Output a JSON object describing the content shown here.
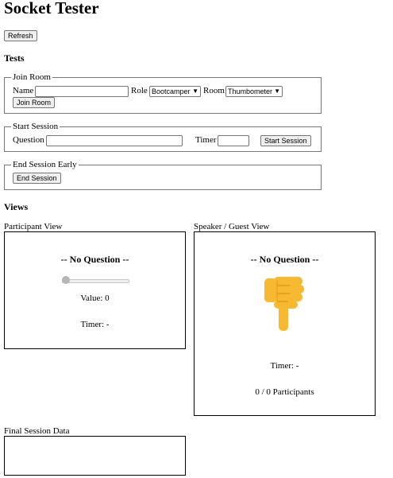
{
  "page_title": "Socket Tester",
  "refresh_label": "Refresh",
  "tests": {
    "heading": "Tests",
    "join_room": {
      "legend": "Join Room",
      "name_label": "Name",
      "name_value": "",
      "role_label": "Role",
      "role_selected": "Bootcamper",
      "room_label": "Room",
      "room_selected": "Thumbometer",
      "button_label": "Join Room"
    },
    "start_session": {
      "legend": "Start Session",
      "question_label": "Question",
      "question_value": "",
      "timer_label": "Timer",
      "timer_value": "",
      "button_label": "Start Session"
    },
    "end_session": {
      "legend": "End Session Early",
      "button_label": "End Session"
    }
  },
  "views": {
    "heading": "Views",
    "participant": {
      "label": "Participant View",
      "question": "-- No Question --",
      "slider_value_fraction": 0,
      "value_text": "Value: 0",
      "timer_text": "Timer: -"
    },
    "speaker": {
      "label": "Speaker / Guest View",
      "question": "-- No Question --",
      "icon": "thumbs-down-icon",
      "icon_color": "#F8B932",
      "timer_text": "Timer: -",
      "participants_text": "0 / 0 Participants"
    }
  },
  "final_session": {
    "label": "Final Session Data",
    "content": ""
  }
}
